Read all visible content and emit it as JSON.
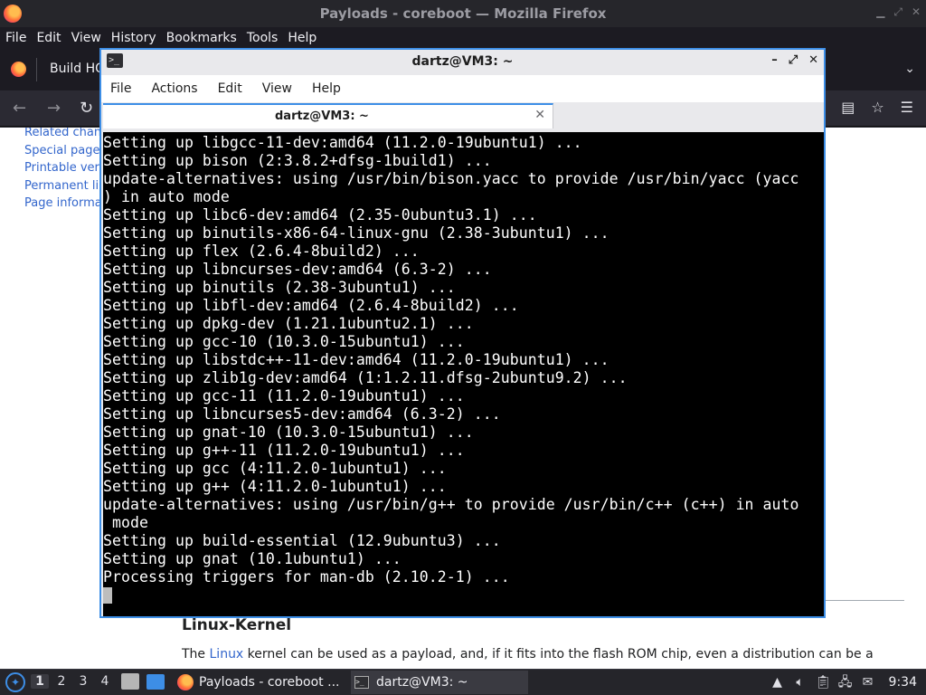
{
  "firefox": {
    "window_title": "Payloads - coreboot — Mozilla Firefox",
    "menu": [
      "File",
      "Edit",
      "View",
      "History",
      "Bookmarks",
      "Tools",
      "Help"
    ],
    "tab_label": "Build HO",
    "sidebar_links": [
      "Related chang",
      "Special pages",
      "Printable vers",
      "Permanent lin",
      "Page informat"
    ],
    "heading": "Linux-Kernel",
    "para_before": "The ",
    "para_link": "Linux",
    "para_after": " kernel can be used as a payload, and, if it fits into the flash ROM chip, even a distribution can be a"
  },
  "terminal": {
    "window_title": "dartz@VM3: ~",
    "menu": [
      "File",
      "Actions",
      "Edit",
      "View",
      "Help"
    ],
    "tab_label": "dartz@VM3: ~",
    "lines": [
      "Setting up libgcc-11-dev:amd64 (11.2.0-19ubuntu1) ...",
      "Setting up bison (2:3.8.2+dfsg-1build1) ...",
      "update-alternatives: using /usr/bin/bison.yacc to provide /usr/bin/yacc (yacc",
      ") in auto mode",
      "Setting up libc6-dev:amd64 (2.35-0ubuntu3.1) ...",
      "Setting up binutils-x86-64-linux-gnu (2.38-3ubuntu1) ...",
      "Setting up flex (2.6.4-8build2) ...",
      "Setting up libncurses-dev:amd64 (6.3-2) ...",
      "Setting up binutils (2.38-3ubuntu1) ...",
      "Setting up libfl-dev:amd64 (2.6.4-8build2) ...",
      "Setting up dpkg-dev (1.21.1ubuntu2.1) ...",
      "Setting up gcc-10 (10.3.0-15ubuntu1) ...",
      "Setting up libstdc++-11-dev:amd64 (11.2.0-19ubuntu1) ...",
      "Setting up zlib1g-dev:amd64 (1:1.2.11.dfsg-2ubuntu9.2) ...",
      "Setting up gcc-11 (11.2.0-19ubuntu1) ...",
      "Setting up libncurses5-dev:amd64 (6.3-2) ...",
      "Setting up gnat-10 (10.3.0-15ubuntu1) ...",
      "Setting up g++-11 (11.2.0-19ubuntu1) ...",
      "Setting up gcc (4:11.2.0-1ubuntu1) ...",
      "Setting up g++ (4:11.2.0-1ubuntu1) ...",
      "update-alternatives: using /usr/bin/g++ to provide /usr/bin/c++ (c++) in auto",
      " mode",
      "Setting up build-essential (12.9ubuntu3) ...",
      "Setting up gnat (10.1ubuntu1) ...",
      "Processing triggers for man-db (2.10.2-1) ..."
    ]
  },
  "taskbar": {
    "workspaces": [
      "1",
      "2",
      "3",
      "4"
    ],
    "active_workspace": "1",
    "tasks": [
      {
        "label": "Payloads - coreboot ..."
      },
      {
        "label": "dartz@VM3: ~"
      }
    ],
    "clock": "9:34"
  },
  "colors": {
    "accent": "#3d8ee6",
    "terminal_bg": "#000000",
    "terminal_fg": "#ffffff",
    "link": "#3366cc"
  }
}
